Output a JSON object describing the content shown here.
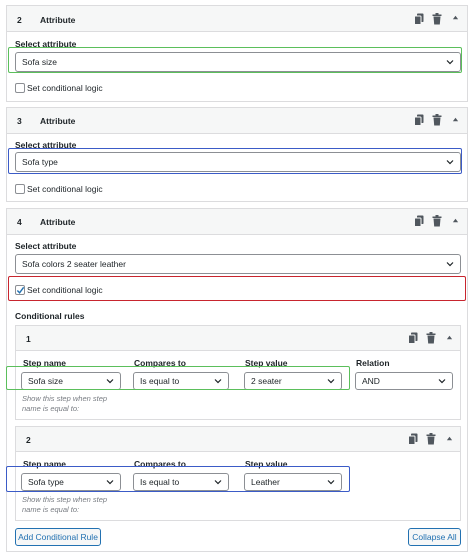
{
  "colors": {
    "highlight_green": "#5bbf5b",
    "highlight_blue": "#3b5bc7",
    "highlight_red": "#c8252e",
    "link_blue": "#2271b1"
  },
  "attributes": [
    {
      "number": "2",
      "title": "Attribute",
      "select_label": "Select attribute",
      "value": "Sofa size",
      "conditional_label": "Set conditional logic",
      "conditional_checked": false
    },
    {
      "number": "3",
      "title": "Attribute",
      "select_label": "Select attribute",
      "value": "Sofa type",
      "conditional_label": "Set conditional logic",
      "conditional_checked": false
    },
    {
      "number": "4",
      "title": "Attribute",
      "select_label": "Select attribute",
      "value": "Sofa colors 2 seater leather",
      "conditional_label": "Set conditional logic",
      "conditional_checked": true
    }
  ],
  "conditional_rules": {
    "heading": "Conditional rules",
    "rules": [
      {
        "number": "1",
        "step_name_label": "Step name",
        "compares_to_label": "Compares to",
        "step_value_label": "Step value",
        "relation_label": "Relation",
        "step_name": "Sofa size",
        "compares_to": "Is equal to",
        "step_value": "2 seater",
        "relation": "AND",
        "helper": "Show this step when step name is equal to:"
      },
      {
        "number": "2",
        "step_name_label": "Step name",
        "compares_to_label": "Compares to",
        "step_value_label": "Step value",
        "step_name": "Sofa type",
        "compares_to": "Is equal to",
        "step_value": "Leather",
        "helper": "Show this step when step name is equal to:"
      }
    ],
    "add_button": "Add Conditional Rule",
    "collapse_button": "Collapse All"
  },
  "icons": {
    "duplicate": "duplicate-icon",
    "delete": "trash-icon",
    "collapse": "caret-up-icon",
    "dropdown": "chevron-down-icon",
    "checkbox": "checkmark-icon"
  }
}
